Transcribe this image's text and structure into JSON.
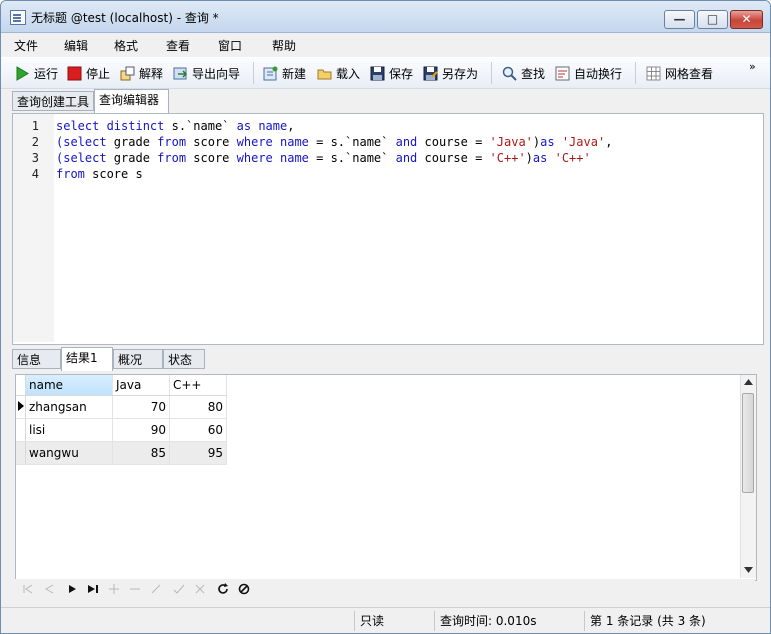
{
  "window": {
    "title": "无标题 @test (localhost) - 查询 *",
    "buttons": {
      "minimize": "—",
      "maximize": "□",
      "close": "✕"
    }
  },
  "menu": [
    "文件",
    "编辑",
    "格式",
    "查看",
    "窗口",
    "帮助"
  ],
  "toolbar": {
    "run": "运行",
    "stop": "停止",
    "explain": "解释",
    "export_wizard": "导出向导",
    "new": "新建",
    "load": "载入",
    "save": "保存",
    "save_as": "另存为",
    "find": "查找",
    "word_wrap": "自动换行",
    "grid_view": "网格查看",
    "more": "»"
  },
  "top_tabs": [
    "查询创建工具",
    "查询编辑器"
  ],
  "editor": {
    "line_numbers": [
      "1",
      "2",
      "3",
      "4"
    ]
  },
  "sql_lines": [
    [
      {
        "t": "select distinct",
        "c": "kw"
      },
      {
        "t": " s.`name` ",
        "c": ""
      },
      {
        "t": "as",
        "c": "kw"
      },
      {
        "t": " ",
        "c": ""
      },
      {
        "t": "name",
        "c": "kw"
      },
      {
        "t": ",",
        "c": ""
      }
    ],
    [
      {
        "t": "(select",
        "c": "kw"
      },
      {
        "t": " grade ",
        "c": ""
      },
      {
        "t": "from",
        "c": "kw"
      },
      {
        "t": " score ",
        "c": ""
      },
      {
        "t": "where",
        "c": "kw"
      },
      {
        "t": " ",
        "c": ""
      },
      {
        "t": "name",
        "c": "kw"
      },
      {
        "t": " = s.`name` ",
        "c": ""
      },
      {
        "t": "and",
        "c": "kw"
      },
      {
        "t": " course = ",
        "c": ""
      },
      {
        "t": "'Java'",
        "c": "str"
      },
      {
        "t": ")",
        "c": ""
      },
      {
        "t": "as",
        "c": "kw"
      },
      {
        "t": " ",
        "c": ""
      },
      {
        "t": "'Java'",
        "c": "str"
      },
      {
        "t": ",",
        "c": ""
      }
    ],
    [
      {
        "t": "(select",
        "c": "kw"
      },
      {
        "t": " grade ",
        "c": ""
      },
      {
        "t": "from",
        "c": "kw"
      },
      {
        "t": " score ",
        "c": ""
      },
      {
        "t": "where",
        "c": "kw"
      },
      {
        "t": " ",
        "c": ""
      },
      {
        "t": "name",
        "c": "kw"
      },
      {
        "t": " = s.`name` ",
        "c": ""
      },
      {
        "t": "and",
        "c": "kw"
      },
      {
        "t": " course = ",
        "c": ""
      },
      {
        "t": "'C++'",
        "c": "str"
      },
      {
        "t": ")",
        "c": ""
      },
      {
        "t": "as",
        "c": "kw"
      },
      {
        "t": " ",
        "c": ""
      },
      {
        "t": "'C++'",
        "c": "str"
      }
    ],
    [
      {
        "t": "from",
        "c": "kw"
      },
      {
        "t": " score s",
        "c": ""
      }
    ]
  ],
  "bottom_tabs": [
    "信息",
    "结果1",
    "概况",
    "状态"
  ],
  "results": {
    "columns": [
      "name",
      "Java",
      "C++"
    ],
    "rows": [
      [
        "zhangsan",
        "70",
        "80"
      ],
      [
        "lisi",
        "90",
        "60"
      ],
      [
        "wangwu",
        "85",
        "95"
      ]
    ]
  },
  "status": {
    "read_only": "只读",
    "query_time": "查询时间: 0.010s",
    "record_info": "第 1 条记录 (共 3 条)"
  },
  "colors": {
    "keyword": "#1515c8",
    "string": "#b01818",
    "title_bar": "#c4d7ee",
    "close_button": "#c8453a"
  }
}
